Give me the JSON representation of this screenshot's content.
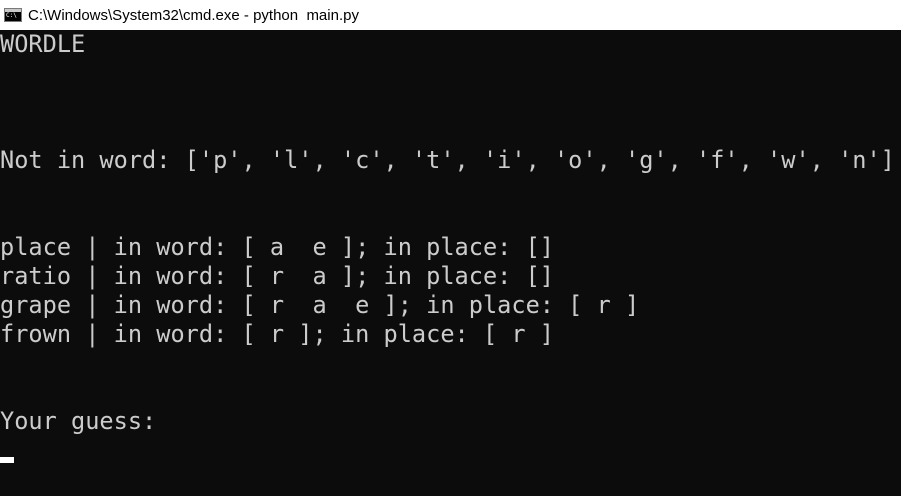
{
  "window": {
    "title": "C:\\Windows\\System32\\cmd.exe - python  main.py",
    "app_icon": "cmd-console-icon",
    "app_icon_text": "C:\\"
  },
  "console": {
    "heading": "WORDLE",
    "not_in_word": "Not in word: ['p', 'l', 'c', 't', 'i', 'o', 'g', 'f', 'w', 'n']",
    "guesses": [
      "place | in word: [ a  e ]; in place: []",
      "ratio | in word: [ r  a ]; in place: []",
      "grape | in word: [ r  a  e ]; in place: [ r ]",
      "frown | in word: [ r ]; in place: [ r ]"
    ],
    "prompt": "Your guess:"
  },
  "colors": {
    "background": "#0c0c0c",
    "text": "#cccccc",
    "titlebar": "#ffffff"
  }
}
